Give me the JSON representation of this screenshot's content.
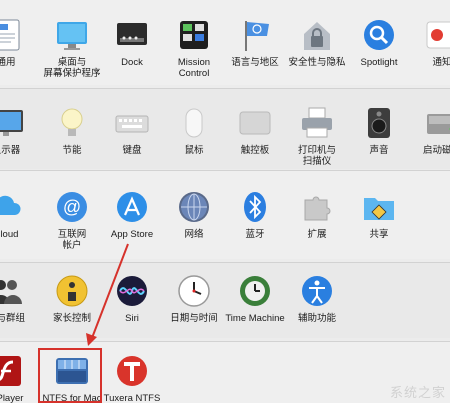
{
  "rows": [
    {
      "items": [
        {
          "name": "pref-general-partial",
          "label": "通用",
          "icon": "doc-icon"
        },
        {
          "name": "pref-desktop-screensaver",
          "label": "桌面与",
          "label2": "屏幕保护程序",
          "icon": "desktop-icon"
        },
        {
          "name": "pref-dock",
          "label": "Dock",
          "icon": "dock-icon"
        },
        {
          "name": "pref-mission-control",
          "label": "Mission",
          "label2": "Control",
          "icon": "mission-control-icon"
        },
        {
          "name": "pref-language-region",
          "label": "语言与地区",
          "icon": "flag-icon"
        },
        {
          "name": "pref-security-privacy",
          "label": "安全性与隐私",
          "icon": "house-lock-icon"
        },
        {
          "name": "pref-spotlight",
          "label": "Spotlight",
          "icon": "magnifier-icon"
        },
        {
          "name": "pref-notifications-partial",
          "label": "通知",
          "icon": "notifications-icon"
        }
      ]
    },
    {
      "items": [
        {
          "name": "pref-displays-partial",
          "label": "显示器",
          "icon": "display-icon"
        },
        {
          "name": "pref-energy-saver",
          "label": "节能",
          "icon": "lightbulb-icon"
        },
        {
          "name": "pref-keyboard",
          "label": "键盘",
          "icon": "keyboard-icon"
        },
        {
          "name": "pref-mouse",
          "label": "鼠标",
          "icon": "mouse-icon"
        },
        {
          "name": "pref-trackpad",
          "label": "触控板",
          "icon": "trackpad-icon"
        },
        {
          "name": "pref-printers-scanners",
          "label": "打印机与",
          "label2": "扫描仪",
          "icon": "printer-icon"
        },
        {
          "name": "pref-sound",
          "label": "声音",
          "icon": "speaker-icon"
        },
        {
          "name": "pref-startup-disk-partial",
          "label": "启动磁盘",
          "icon": "disk-icon"
        }
      ]
    },
    {
      "items": [
        {
          "name": "pref-icloud-partial",
          "label": "Cloud",
          "icon": "cloud-icon"
        },
        {
          "name": "pref-internet-accounts",
          "label": "互联网",
          "label2": "帐户",
          "icon": "at-sign-icon"
        },
        {
          "name": "pref-app-store",
          "label": "App Store",
          "icon": "app-store-icon"
        },
        {
          "name": "pref-network",
          "label": "网络",
          "icon": "globe-icon"
        },
        {
          "name": "pref-bluetooth",
          "label": "蓝牙",
          "icon": "bluetooth-icon"
        },
        {
          "name": "pref-extensions",
          "label": "扩展",
          "icon": "puzzle-icon"
        },
        {
          "name": "pref-sharing",
          "label": "共享",
          "icon": "folder-sharing-icon"
        }
      ]
    },
    {
      "items": [
        {
          "name": "pref-users-groups-partial",
          "label": "户与群组",
          "icon": "users-icon"
        },
        {
          "name": "pref-parental-controls",
          "label": "家长控制",
          "icon": "parental-icon"
        },
        {
          "name": "pref-siri",
          "label": "Siri",
          "icon": "siri-icon"
        },
        {
          "name": "pref-date-time",
          "label": "日期与时间",
          "icon": "clock-icon"
        },
        {
          "name": "pref-time-machine",
          "label": "Time Machine",
          "icon": "time-machine-icon"
        },
        {
          "name": "pref-accessibility",
          "label": "辅助功能",
          "icon": "accessibility-icon"
        }
      ]
    },
    {
      "items": [
        {
          "name": "pref-flash-player-partial",
          "label": "h Player",
          "icon": "flash-icon"
        },
        {
          "name": "pref-ntfs-for-mac",
          "label": "NTFS for Mac",
          "icon": "ntfs-icon"
        },
        {
          "name": "pref-tuxera-ntfs",
          "label": "Tuxera NTFS",
          "icon": "tuxera-icon"
        }
      ]
    }
  ],
  "annotation": {
    "color": "#d6322b"
  },
  "watermark": "系统之家"
}
